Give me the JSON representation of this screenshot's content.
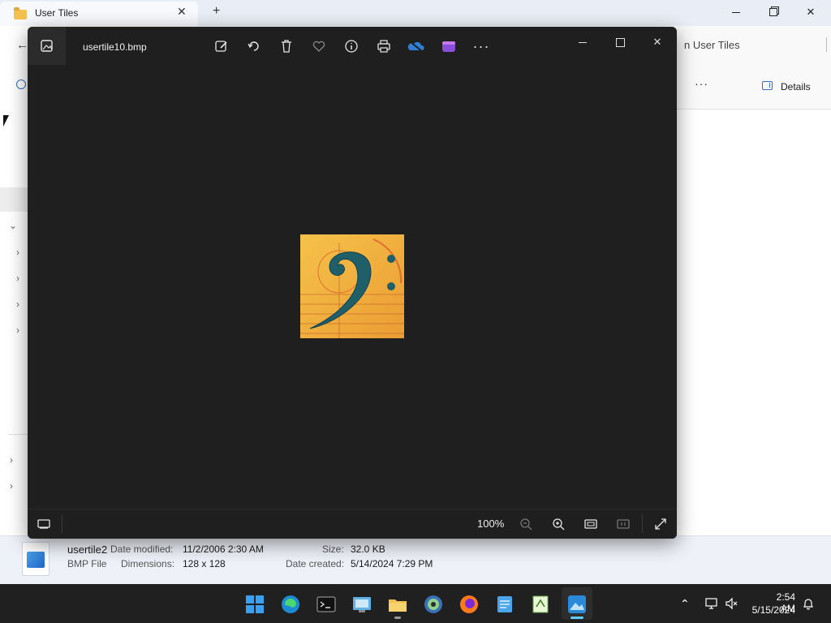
{
  "explorer": {
    "tab_title": "User Tiles",
    "new_tab_symbol": "+",
    "close_symbol": "✕",
    "address_tail": "n User Tiles",
    "more_label": "···",
    "details_label": "Details",
    "status": {
      "file_name": "usertile2",
      "file_type": "BMP File",
      "date_modified_label": "Date modified:",
      "date_modified_value": "11/2/2006 2:30 AM",
      "dimensions_label": "Dimensions:",
      "dimensions_value": "128 x 128",
      "size_label": "Size:",
      "size_value": "32.0 KB",
      "date_created_label": "Date created:",
      "date_created_value": "5/14/2024 7:29 PM"
    }
  },
  "viewer": {
    "file_title": "usertile10.bmp",
    "toolbar_icons": [
      "edit-icon",
      "rotate-icon",
      "delete-icon",
      "favorite-icon",
      "info-icon",
      "print-icon",
      "onedrive-icon",
      "clipchamp-icon",
      "more-icon"
    ],
    "zoom_label": "100%",
    "image_colors": {
      "background": "#f0b23a",
      "clef": "#1f5f6a",
      "accent": "#d9532b"
    }
  },
  "taskbar": {
    "time": "2:54 AM",
    "date": "5/15/2024",
    "apps": [
      "start-icon",
      "edge-icon",
      "terminal-icon",
      "control-panel-icon",
      "file-explorer-icon",
      "media-player-icon",
      "firefox-icon",
      "notepad-icon",
      "text-editor-icon",
      "photos-icon"
    ]
  }
}
